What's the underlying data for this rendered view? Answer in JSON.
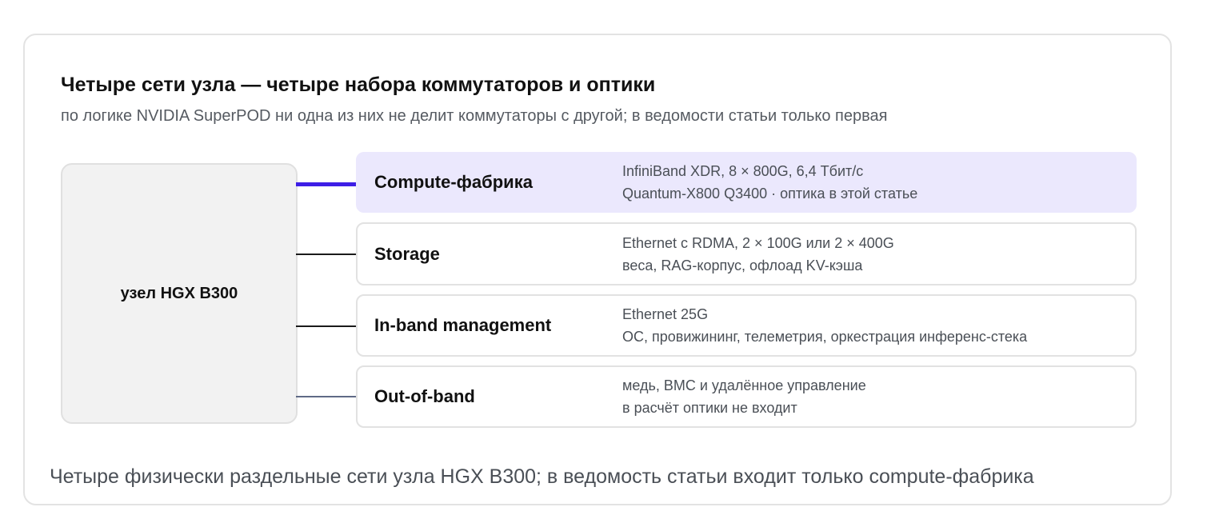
{
  "header": {
    "title": "Четыре сети узла — четыре набора коммутаторов и оптики",
    "subtitle": "по логике NVIDIA SuperPOD ни одна из них не делит коммутаторы с другой; в ведомости статьи только первая"
  },
  "node": {
    "label": "узел HGX B300"
  },
  "networks": [
    {
      "name": "Compute-фабрика",
      "line1": "InfiniBand XDR, 8 × 800G, 6,4 Тбит/с",
      "line2": "Quantum-X800 Q3400 · оптика в этой статье",
      "highlighted": true
    },
    {
      "name": "Storage",
      "line1": "Ethernet с RDMA, 2 × 100G или 2 × 400G",
      "line2": "веса, RAG-корпус, офлоад KV-кэша",
      "highlighted": false
    },
    {
      "name": "In-band management",
      "line1": "Ethernet 25G",
      "line2": "ОС, провижининг, телеметрия, оркестрация инференс-стека",
      "highlighted": false
    },
    {
      "name": "Out-of-band",
      "line1": "медь, BMC и удалённое управление",
      "line2": "в расчёт оптики не входит",
      "highlighted": false
    }
  ],
  "caption": "Четыре физически раздельные сети узла HGX B300; в ведомость статьи входит только compute-фабрика",
  "colors": {
    "accent": "#3d1ee6",
    "highlight_bg": "#ebe8fd",
    "node_bg": "#f2f2f2",
    "muted_line": "#5f6a86"
  }
}
